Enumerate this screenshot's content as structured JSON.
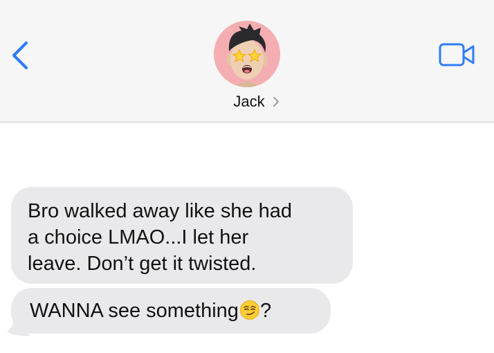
{
  "header": {
    "contact_name": "Jack",
    "back_icon": "chevron-left-icon",
    "video_icon": "video-camera-icon",
    "accent_color": "#2f7cf6",
    "avatar_bg": "#f4aeb1"
  },
  "messages": [
    {
      "sender": "incoming",
      "lines": [
        "Bro walked away like she had",
        "a choice LMAO...I let her",
        "leave. Don’t get it twisted."
      ]
    },
    {
      "sender": "incoming",
      "text_before": "WANNA see something",
      "emoji": "smirking-face-emoji",
      "text_after": "?"
    }
  ],
  "bubble_color": "#e9e9eb"
}
